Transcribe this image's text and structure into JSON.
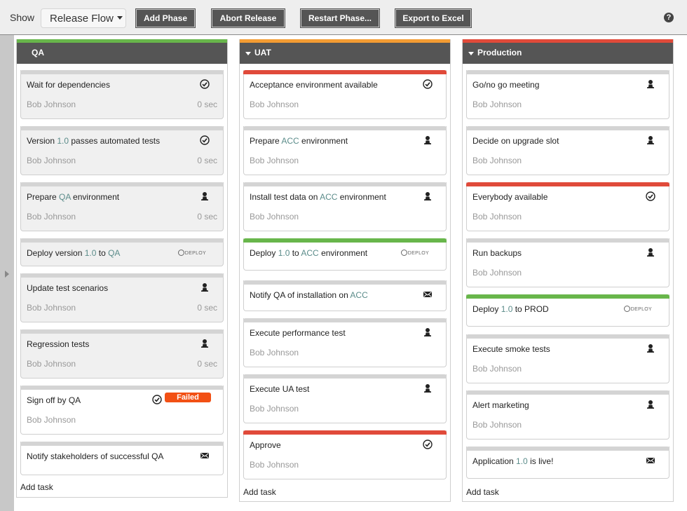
{
  "toolbar": {
    "show_label": "Show",
    "flow_select": "Release Flow",
    "buttons": [
      "Add Phase",
      "Abort Release",
      "Restart Phase...",
      "Export to Excel"
    ],
    "help_icon": "?"
  },
  "colors": {
    "done": "#68b64b",
    "in_progress": "#f39c33",
    "failed": "#e04a3a",
    "pending": "#d4d4d4",
    "failed_badge": "#f25014",
    "header": "#555555"
  },
  "phases": [
    {
      "name": "QA",
      "status_color": "#68b64b",
      "collapsible": false,
      "add_task": "Add task",
      "tasks": [
        {
          "title": [
            "Wait for dependencies"
          ],
          "owner": "Bob Johnson",
          "duration": "0 sec",
          "icon": "check-circle-icon",
          "bar": "grey",
          "done": true
        },
        {
          "title": [
            "Version ",
            {
              "hl": "1.0"
            },
            " passes automated tests"
          ],
          "owner": "Bob Johnson",
          "duration": "0 sec",
          "icon": "check-circle-icon",
          "bar": "grey",
          "done": true
        },
        {
          "title": [
            "Prepare ",
            {
              "hl": "QA"
            },
            " environment"
          ],
          "owner": "Bob Johnson",
          "duration": "0 sec",
          "icon": "user-icon",
          "bar": "grey",
          "done": true
        },
        {
          "title": [
            "Deploy version ",
            {
              "hl": "1.0"
            },
            " to ",
            {
              "hl": "QA"
            }
          ],
          "icon": "deploy-icon",
          "deploy_label": "DEPLOY",
          "bar": "grey",
          "done": true
        },
        {
          "title": [
            "Update test scenarios"
          ],
          "owner": "Bob Johnson",
          "duration": "0 sec",
          "icon": "user-icon",
          "bar": "grey",
          "done": true
        },
        {
          "title": [
            "Regression tests"
          ],
          "owner": "Bob Johnson",
          "duration": "0 sec",
          "icon": "user-icon",
          "bar": "grey",
          "done": true
        },
        {
          "title": [
            "Sign off by QA"
          ],
          "owner": "Bob Johnson",
          "icon": "check-circle-icon",
          "badge": "Failed",
          "bar": "grey",
          "done": false
        },
        {
          "title": [
            "Notify stakeholders of successful QA"
          ],
          "icon": "mail-icon",
          "bar": "grey",
          "done": false
        }
      ]
    },
    {
      "name": "UAT",
      "status_color": "#f39c33",
      "collapsible": true,
      "add_task": "Add task",
      "tasks": [
        {
          "title": [
            "Acceptance environment available"
          ],
          "owner": "Bob Johnson",
          "icon": "check-circle-icon",
          "bar": "red"
        },
        {
          "title": [
            "Prepare ",
            {
              "hl": "ACC"
            },
            " environment"
          ],
          "owner": "Bob Johnson",
          "icon": "user-icon",
          "bar": "grey"
        },
        {
          "title": [
            "Install test data on ",
            {
              "hl": "ACC"
            },
            " environment"
          ],
          "owner": "Bob Johnson",
          "icon": "user-icon",
          "bar": "grey"
        },
        {
          "title": [
            "Deploy ",
            {
              "hl": "1.0"
            },
            " to ",
            {
              "hl": "ACC"
            },
            " environment"
          ],
          "icon": "deploy-icon",
          "deploy_label": "DEPLOY",
          "bar": "green"
        },
        {
          "title": [
            "Notify QA of installation on ",
            {
              "hl": "ACC"
            }
          ],
          "icon": "mail-icon",
          "bar": "grey"
        },
        {
          "title": [
            "Execute performance test"
          ],
          "owner": "Bob Johnson",
          "icon": "user-icon",
          "bar": "grey"
        },
        {
          "title": [
            "Execute UA test"
          ],
          "owner": "Bob Johnson",
          "icon": "user-icon",
          "bar": "grey"
        },
        {
          "title": [
            "Approve"
          ],
          "owner": "Bob Johnson",
          "icon": "check-circle-icon",
          "bar": "red"
        }
      ]
    },
    {
      "name": "Production",
      "status_color": "#e04a3a",
      "collapsible": true,
      "add_task": "Add task",
      "tasks": [
        {
          "title": [
            "Go/no go meeting"
          ],
          "owner": "Bob Johnson",
          "icon": "user-icon",
          "bar": "grey"
        },
        {
          "title": [
            "Decide on upgrade slot"
          ],
          "owner": "Bob Johnson",
          "icon": "user-icon",
          "bar": "grey"
        },
        {
          "title": [
            "Everybody available"
          ],
          "owner": "Bob Johnson",
          "icon": "check-circle-icon",
          "bar": "red"
        },
        {
          "title": [
            "Run backups"
          ],
          "owner": "Bob Johnson",
          "icon": "user-icon",
          "bar": "grey"
        },
        {
          "title": [
            "Deploy ",
            {
              "hl": "1.0"
            },
            " to PROD"
          ],
          "icon": "deploy-icon",
          "deploy_label": "DEPLOY",
          "bar": "green"
        },
        {
          "title": [
            "Execute smoke tests"
          ],
          "owner": "Bob Johnson",
          "icon": "user-icon",
          "bar": "grey"
        },
        {
          "title": [
            "Alert marketing"
          ],
          "owner": "Bob Johnson",
          "icon": "user-icon",
          "bar": "grey"
        },
        {
          "title": [
            "Application ",
            {
              "hl": "1.0"
            },
            " is live!"
          ],
          "icon": "mail-icon",
          "bar": "grey"
        }
      ]
    }
  ]
}
